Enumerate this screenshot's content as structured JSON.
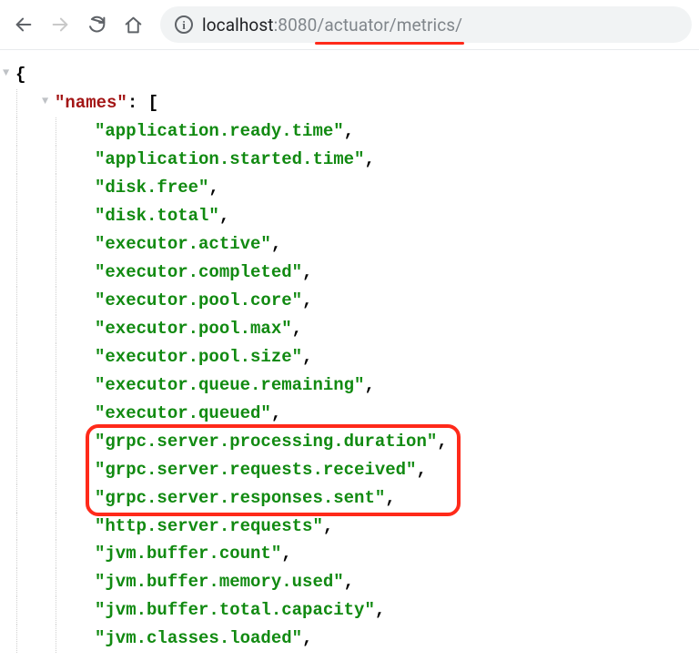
{
  "browser": {
    "url_host": "localhost",
    "url_port": ":8080",
    "url_path": "/actuator/metrics/"
  },
  "json": {
    "rootOpen": "{",
    "keyLabel": "\"names\"",
    "arrayOpen": ": [",
    "items": [
      "\"application.ready.time\"",
      "\"application.started.time\"",
      "\"disk.free\"",
      "\"disk.total\"",
      "\"executor.active\"",
      "\"executor.completed\"",
      "\"executor.pool.core\"",
      "\"executor.pool.max\"",
      "\"executor.pool.size\"",
      "\"executor.queue.remaining\"",
      "\"executor.queued\"",
      "\"grpc.server.processing.duration\"",
      "\"grpc.server.requests.received\"",
      "\"grpc.server.responses.sent\"",
      "\"http.server.requests\"",
      "\"jvm.buffer.count\"",
      "\"jvm.buffer.memory.used\"",
      "\"jvm.buffer.total.capacity\"",
      "\"jvm.classes.loaded\""
    ],
    "highlightStart": 11,
    "highlightEnd": 13
  }
}
